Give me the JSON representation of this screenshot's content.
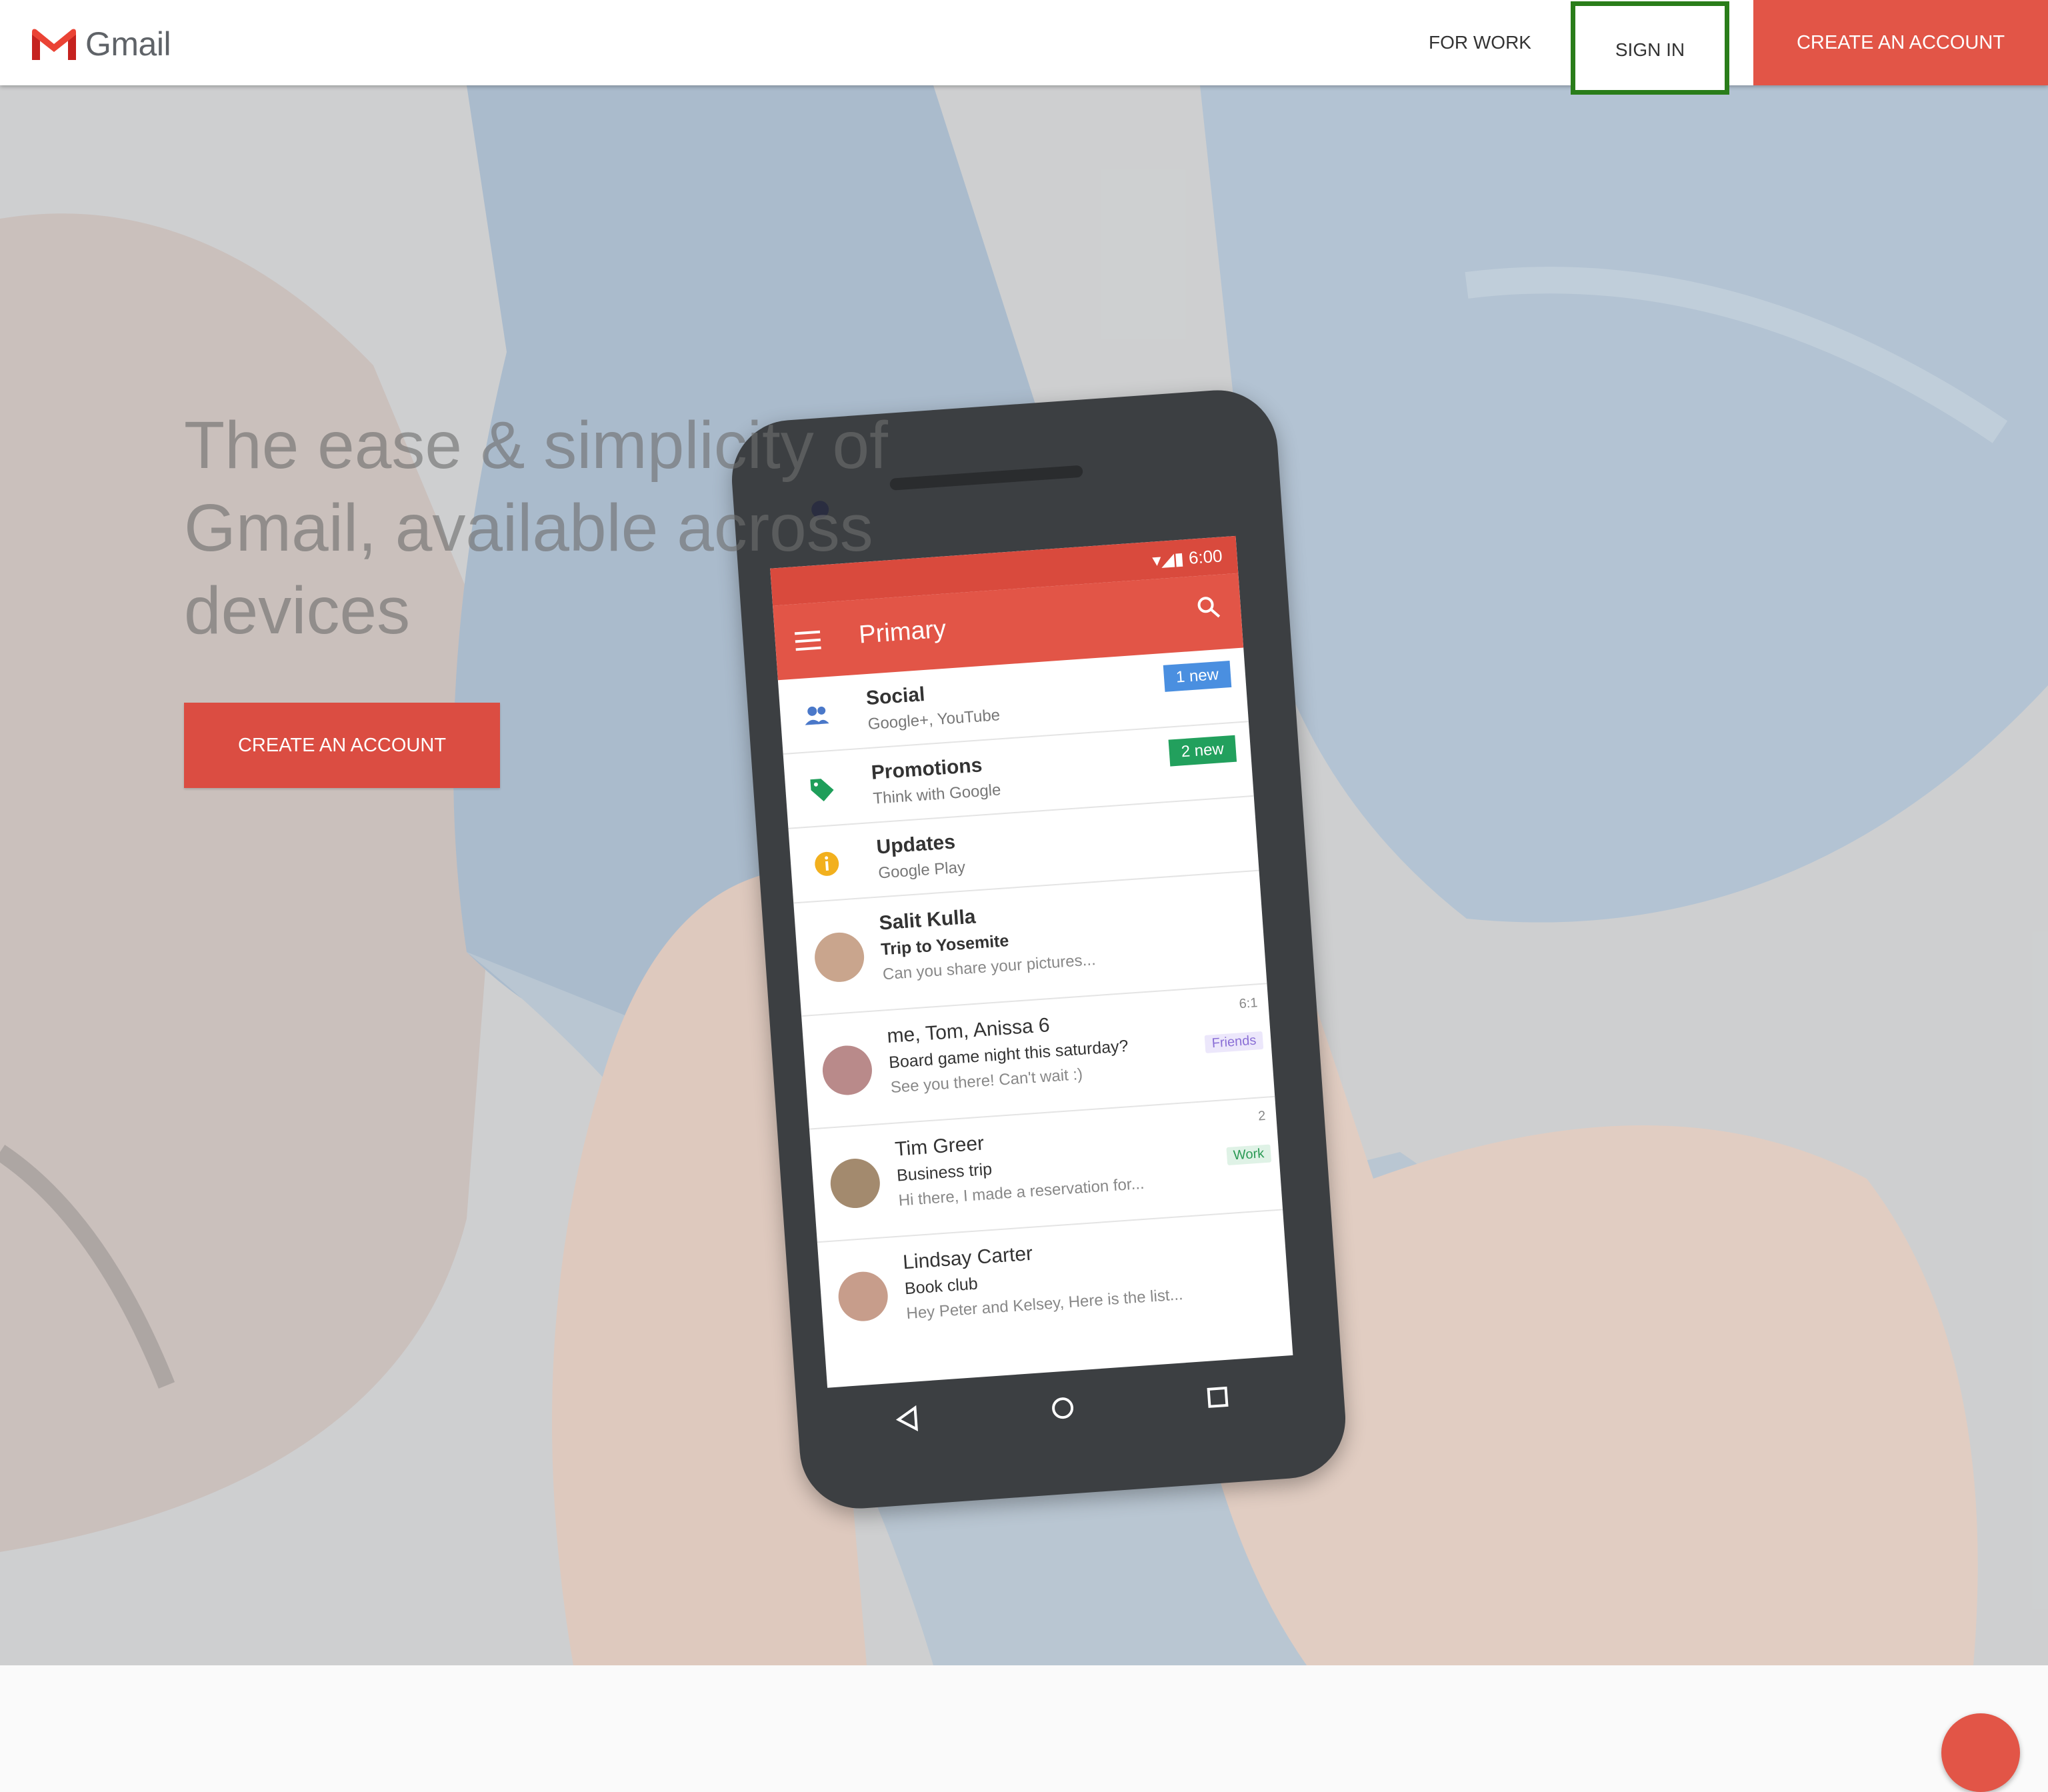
{
  "header": {
    "brand": "Gmail",
    "nav_for_work": "FOR WORK",
    "nav_sign_in": "SIGN IN",
    "nav_create_account": "CREATE AN ACCOUNT"
  },
  "hero": {
    "title": "The ease & simplicity of Gmail, available across devices",
    "cta": "CREATE AN ACCOUNT"
  },
  "phone": {
    "status_time": "6:00",
    "appbar_title": "Primary",
    "categories": [
      {
        "name": "Social",
        "sub": "Google+, YouTube",
        "badge": "1 new"
      },
      {
        "name": "Promotions",
        "sub": "Think with Google",
        "badge": "2 new"
      },
      {
        "name": "Updates",
        "sub": "Google Play"
      }
    ],
    "emails": [
      {
        "from": "Salit Kulla",
        "subject": "Trip to Yosemite",
        "preview": "Can you share your pictures..."
      },
      {
        "from": "me, Tom, Anissa 6",
        "subject": "Board game night this saturday?",
        "preview": "See you there! Can't wait :)",
        "tag": "Friends",
        "time": "6:1"
      },
      {
        "from": "Tim Greer",
        "subject": "Business trip",
        "preview": "Hi there, I made a reservation for...",
        "tag": "Work",
        "time": "2"
      },
      {
        "from": "Lindsay Carter",
        "subject": "Book club",
        "preview": "Hey Peter and Kelsey, Here is the list..."
      }
    ]
  },
  "colors": {
    "brand_red": "#e25547",
    "cta_red": "#db4d42",
    "highlight_green": "#2a7d1a"
  }
}
